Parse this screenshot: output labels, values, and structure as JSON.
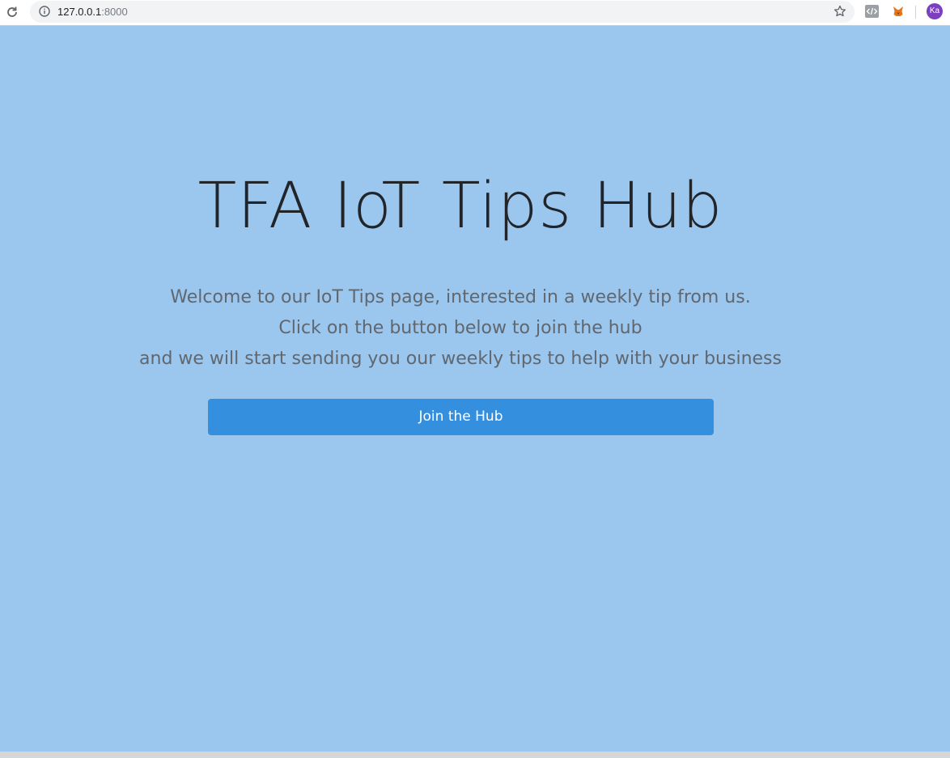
{
  "browser": {
    "url_host": "127.0.0.1",
    "url_port": ":8000",
    "avatar_initials": "Ka",
    "icons": {
      "reload": "reload-icon",
      "info": "info-icon",
      "bookmark": "star-icon",
      "extension_1": "code-extension-icon",
      "extension_2": "fox-extension-icon"
    },
    "colors": {
      "avatar_bg": "#7b3fbf",
      "omnibox_bg": "#f1f3f4"
    }
  },
  "hero": {
    "title": "TFA IoT Tips Hub",
    "lines": [
      "Welcome to our IoT Tips page, interested in a weekly tip from us.",
      "Click on the button below to join the hub",
      "and we will start sending you our weekly tips to help with your business"
    ],
    "button_label": "Join the Hub"
  },
  "colors": {
    "page_bg": "#9bc6ee",
    "button_bg": "#348fdf",
    "title_color": "#212529",
    "text_color": "#60676f"
  }
}
